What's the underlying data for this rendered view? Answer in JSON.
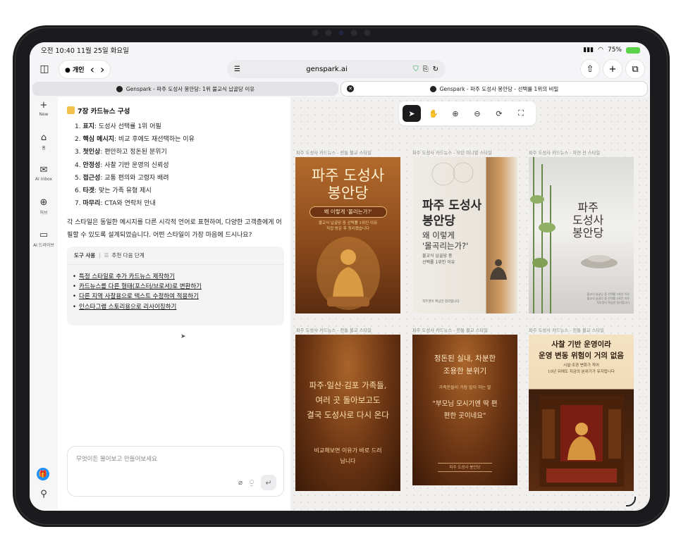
{
  "status": {
    "time": "오전 10:40",
    "date": "11월 25일 화요일",
    "battery": "75%"
  },
  "toolbar": {
    "profile": "개인",
    "url": "genspark.ai"
  },
  "tabs": [
    {
      "label": "Genspark - 파주 도성사 봉안당: 1위 불교식 납골당 이유"
    },
    {
      "label": "Genspark - 파주 도성사 봉안당 - 선택률 1위의 비밀"
    }
  ],
  "sidebar": {
    "new": "New",
    "home": "홈",
    "inbox": "AI Inbox",
    "hub": "허브",
    "drive": "AI 드라이브"
  },
  "chat": {
    "title": "7장 카드뉴스 구성",
    "items": [
      {
        "num": "1.",
        "key": "표지",
        "text": ": 도성사 선택률 1위 어필"
      },
      {
        "num": "2.",
        "key": "핵심 메시지",
        "text": ": 비교 후에도 재선택하는 이유"
      },
      {
        "num": "3.",
        "key": "첫인상",
        "text": ": 편안하고 정돈된 분위기"
      },
      {
        "num": "4.",
        "key": "안정성",
        "text": ": 사찰 기반 운영의 신뢰성"
      },
      {
        "num": "5.",
        "key": "접근성",
        "text": ": 교통 편의와 고령자 배려"
      },
      {
        "num": "6.",
        "key": "타겟",
        "text": ": 맞는 가족 유형 제시"
      },
      {
        "num": "7.",
        "key": "마무리",
        "text": ": CTA와 연락처 안내"
      }
    ],
    "paragraph": "각 스타일은 동일한 메시지를 다른 시각적 언어로 표현하여, 다양한 고객층에게 어필할 수 있도록 설계되었습니다. 어떤 스타일이 가장 마음에 드시나요?",
    "tools_label": "도구 사용",
    "tools_next": "추천 다음 단계",
    "suggestions": [
      "특정 스타일로 추가 카드뉴스 제작하기",
      "카드뉴스를 다른 형태(포스터/브로셔)로 변환하기",
      "다른 지역 사찰용으로 텍스트 수정하여 적용하기",
      "인스타그램 스토리용으로 리사이징하기"
    ],
    "input_placeholder": "무엇이든 물어보고 만들어보세요"
  },
  "canvas": {
    "captions": [
      "파주 도성사 카드뉴스 - 전통 불교 스타일",
      "파주 도성사 카드뉴스 - 모던 미니멀 스타일",
      "파주 도성사 카드뉴스 - 자연 선 스타일",
      "파주 도성사 카드뉴스 - 전통 불교 스타일",
      "파주 도성사 카드뉴스 - 전통 불교 스타일",
      "파주 도성사 카드뉴스 - 전통 불교 스타일"
    ],
    "card1": {
      "title1": "파주 도성사",
      "title2": "봉안당",
      "ribbon": "왜 이렇게 '몰리는가?'",
      "sub1": "불교식 납골당 중 선택률 1위인 이유",
      "sub2": "직접 방문 후 정리했습니다"
    },
    "card2": {
      "title1": "파주 도성사",
      "title2": "봉안당",
      "mid1": "왜 이렇게",
      "mid2": "'몰곡리는가?'",
      "sub1": "불교식 납골당 중",
      "sub2": "선택률 1위인 이유",
      "foot": "직부경이 핵심만 정리합니다"
    },
    "card3": {
      "title1": "파주",
      "title2": "도성사",
      "title3": "봉안당",
      "sub1": "불교식 납골당 중 선택률 1위인 이유",
      "sub2": "불교식 납골당 중 선택률 1위인 이유",
      "sub3": "직부경이 핵심만 정리합니다"
    },
    "card4": {
      "line1": "파주·일산·김포 가족들,",
      "line2": "여러 곳 돌아보고도",
      "line3": "결국 도성사로 다시 온다",
      "foot1": "비교해보면 이유가 바로 드러",
      "foot2": "납니다"
    },
    "card5": {
      "line1": "정돈된 실내, 차분한",
      "line2": "조용한 분위기",
      "sub": "가족분들이 가장 많이 하는 말",
      "q1": "\"부모님 모시기엔 딱 편",
      "q2": "편한 곳이네요\"",
      "foot": "파주 도성사 봉안당"
    },
    "card6": {
      "line1": "사찰 기반 운영이라",
      "line2": "운영 변동 위험이 거의 없음",
      "sub1": "시설·조경 변화가 적어",
      "sub2": "10년 뒤에도 지금의 분위기가 유지됩니다"
    }
  }
}
